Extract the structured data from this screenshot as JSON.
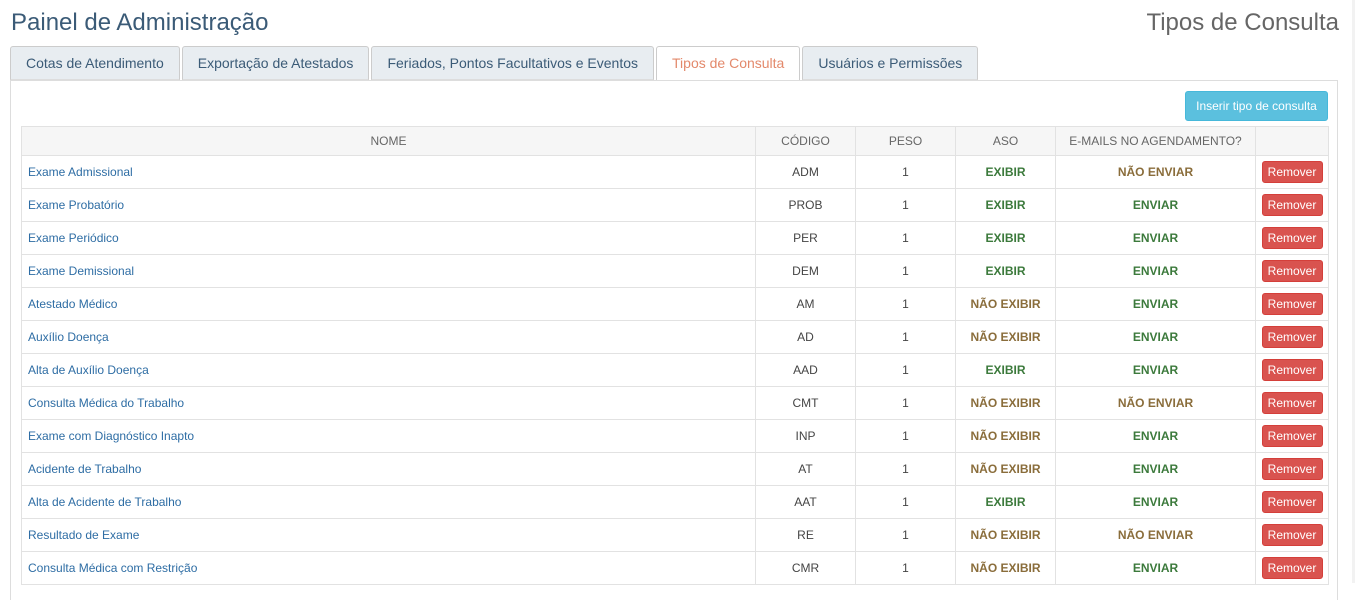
{
  "header": {
    "title": "Painel de Administração",
    "section": "Tipos de Consulta"
  },
  "tabs": [
    {
      "label": "Cotas de Atendimento",
      "active": false
    },
    {
      "label": "Exportação de Atestados",
      "active": false
    },
    {
      "label": "Feriados, Pontos Facultativos e Eventos",
      "active": false
    },
    {
      "label": "Tipos de Consulta",
      "active": true
    },
    {
      "label": "Usuários e Permissões",
      "active": false
    }
  ],
  "toolbar": {
    "insert_label": "Inserir tipo de consulta"
  },
  "table": {
    "headers": [
      "NOME",
      "CÓDIGO",
      "PESO",
      "ASO",
      "E-MAILS NO AGENDAMENTO?",
      ""
    ],
    "remove_label": "Remover",
    "rows": [
      {
        "nome": "Exame Admissional",
        "codigo": "ADM",
        "peso": "1",
        "aso": "EXIBIR",
        "email": "NÃO ENVIAR"
      },
      {
        "nome": "Exame Probatório",
        "codigo": "PROB",
        "peso": "1",
        "aso": "EXIBIR",
        "email": "ENVIAR"
      },
      {
        "nome": "Exame Periódico",
        "codigo": "PER",
        "peso": "1",
        "aso": "EXIBIR",
        "email": "ENVIAR"
      },
      {
        "nome": "Exame Demissional",
        "codigo": "DEM",
        "peso": "1",
        "aso": "EXIBIR",
        "email": "ENVIAR"
      },
      {
        "nome": "Atestado Médico",
        "codigo": "AM",
        "peso": "1",
        "aso": "NÃO EXIBIR",
        "email": "ENVIAR"
      },
      {
        "nome": "Auxílio Doença",
        "codigo": "AD",
        "peso": "1",
        "aso": "NÃO EXIBIR",
        "email": "ENVIAR"
      },
      {
        "nome": "Alta de Auxílio Doença",
        "codigo": "AAD",
        "peso": "1",
        "aso": "EXIBIR",
        "email": "ENVIAR"
      },
      {
        "nome": "Consulta Médica do Trabalho",
        "codigo": "CMT",
        "peso": "1",
        "aso": "NÃO EXIBIR",
        "email": "NÃO ENVIAR"
      },
      {
        "nome": "Exame com Diagnóstico Inapto",
        "codigo": "INP",
        "peso": "1",
        "aso": "NÃO EXIBIR",
        "email": "ENVIAR"
      },
      {
        "nome": "Acidente de Trabalho",
        "codigo": "AT",
        "peso": "1",
        "aso": "NÃO EXIBIR",
        "email": "ENVIAR"
      },
      {
        "nome": "Alta de Acidente de Trabalho",
        "codigo": "AAT",
        "peso": "1",
        "aso": "EXIBIR",
        "email": "ENVIAR"
      },
      {
        "nome": "Resultado de Exame",
        "codigo": "RE",
        "peso": "1",
        "aso": "NÃO EXIBIR",
        "email": "NÃO ENVIAR"
      },
      {
        "nome": "Consulta Médica com Restrição",
        "codigo": "CMR",
        "peso": "1",
        "aso": "NÃO EXIBIR",
        "email": "ENVIAR"
      }
    ]
  },
  "colors": {
    "positive": "#3c7a3c",
    "negative": "#8a6d3b",
    "danger": "#d9534f",
    "info": "#5bc0de",
    "active_tab": "#e3896b"
  }
}
